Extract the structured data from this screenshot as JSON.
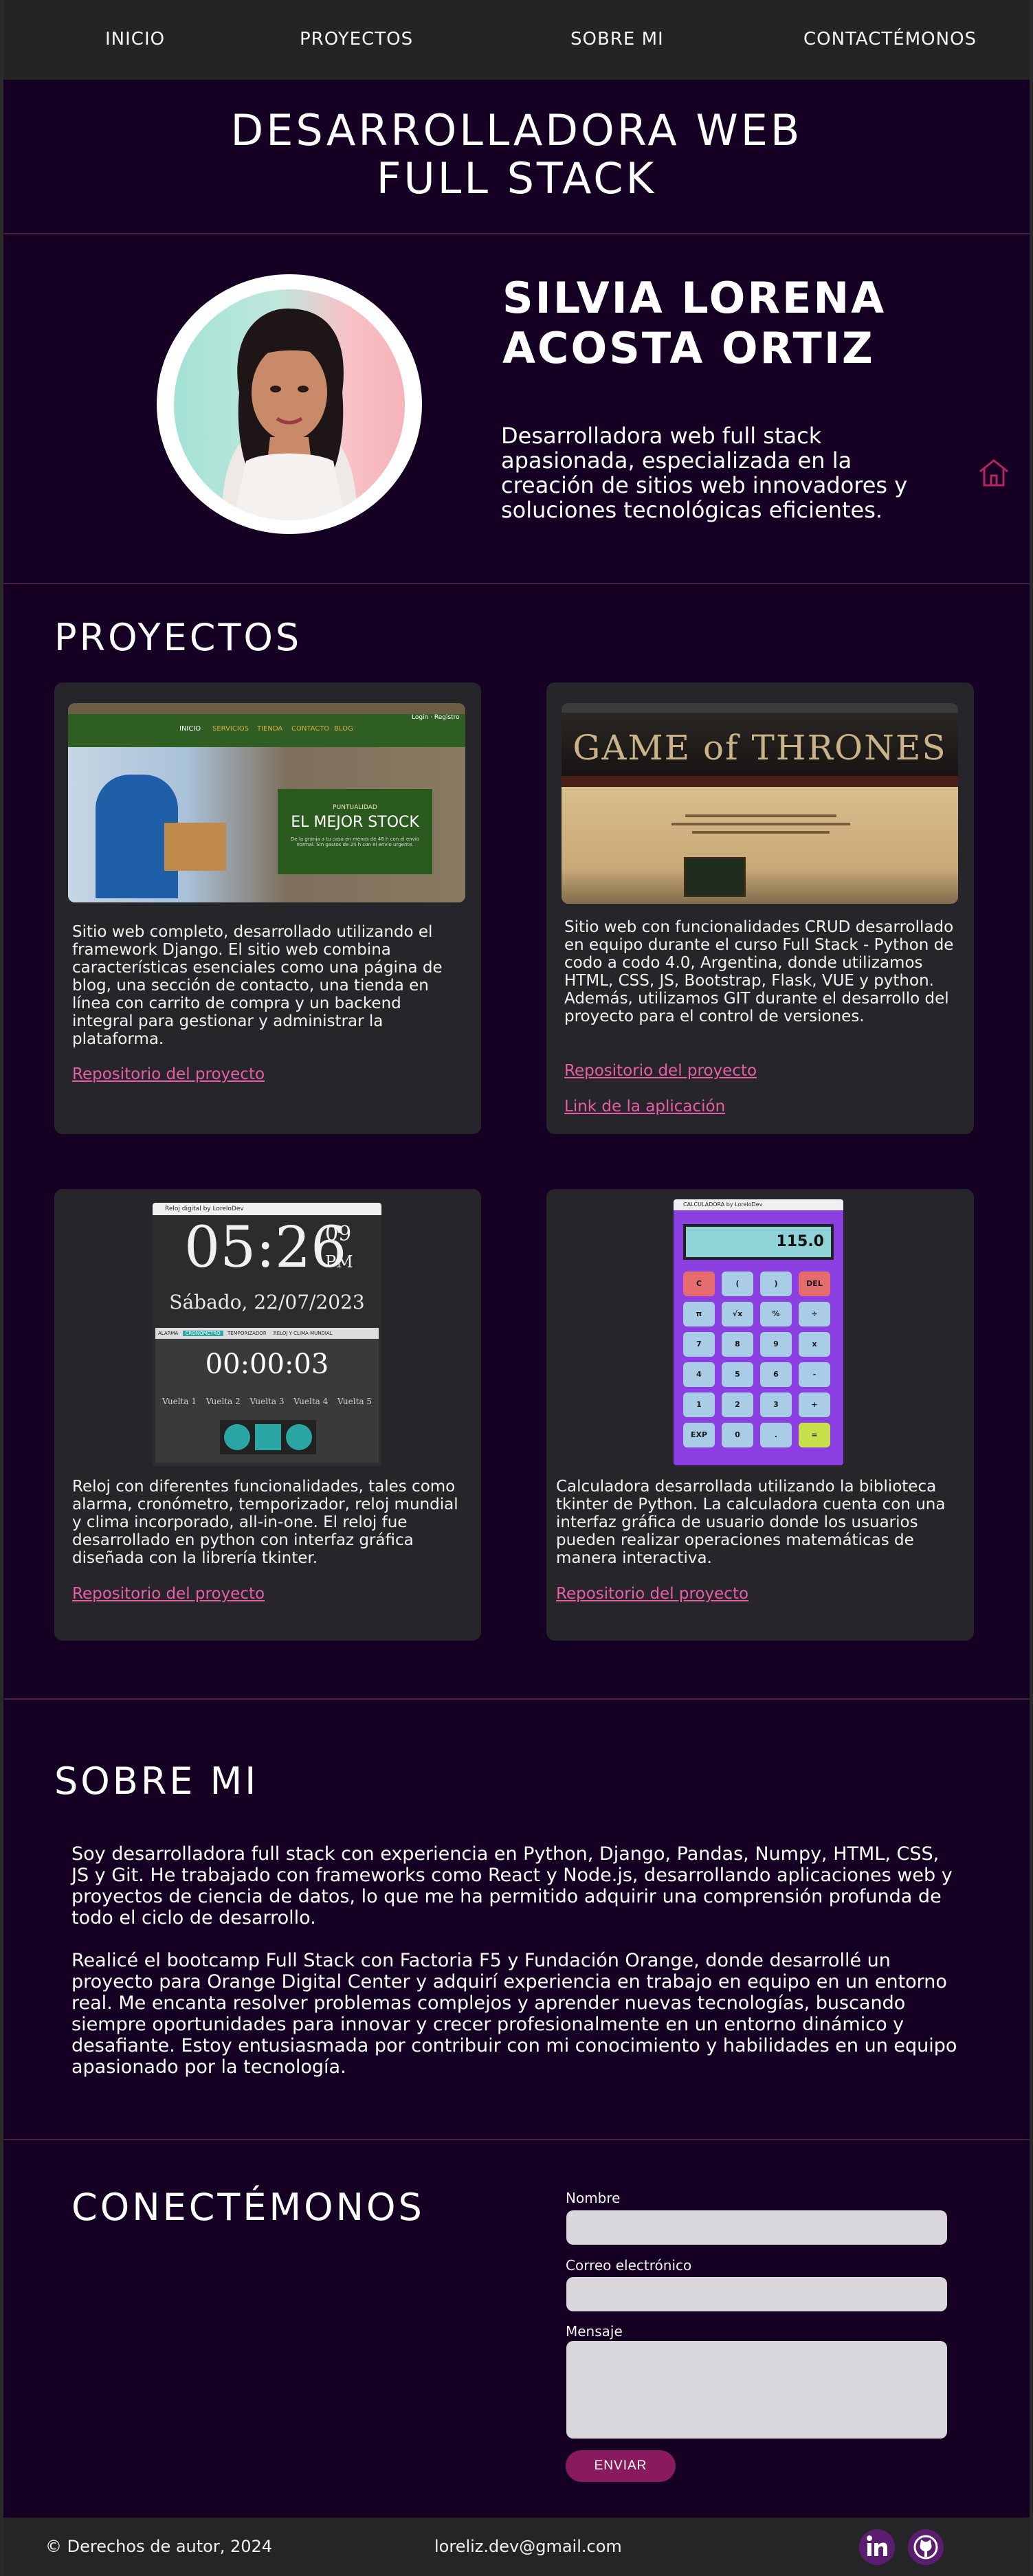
{
  "nav": {
    "items": [
      "INICIO",
      "PROYECTOS",
      "SOBRE MI",
      "CONTACTÉMONOS"
    ]
  },
  "hero": {
    "title_line1": "DESARROLLADORA WEB",
    "title_line2": "FULL STACK"
  },
  "profile": {
    "name_line1": "SILVIA  LORENA",
    "name_line2": "ACOSTA  ORTIZ",
    "tagline": "Desarrolladora web full stack apasionada, especializada en la creación de sitios web innovadores y soluciones tecnológicas eficientes."
  },
  "projects": {
    "title": "PROYECTOS",
    "items": [
      {
        "description": "Sitio web completo, desarrollado utilizando el framework Django. El sitio web combina características esenciales como una página de blog, una sección de contacto, una tienda en línea con carrito de compra y un backend integral para gestionar y administrar la plataforma.",
        "links": [
          "Repositorio del proyecto"
        ],
        "shot": {
          "nav": [
            "INICIO",
            "SERVICIOS",
            "TIENDA",
            "CONTACTO",
            "BLOG"
          ],
          "corner": "Login · Registro",
          "eyebrow": "PUNTUALIDAD",
          "headline": "EL MEJOR STOCK",
          "sub": "De la granja a tu casa en menos de 48 h con el envío normal. Sin gastos de 24 h con el envío urgente."
        }
      },
      {
        "description": "Sitio web con funcionalidades CRUD desarrollado en equipo durante el curso Full Stack - Python de codo a codo 4.0, Argentina, donde utilizamos HTML, CSS, JS, Bootstrap, Flask, VUE y python. Además, utilizamos GIT durante el desarrollo del proyecto para el control de versiones.",
        "links": [
          "Repositorio del proyecto",
          "Link de la aplicación"
        ],
        "shot": {
          "banner": "GAME of THRONES"
        }
      },
      {
        "description": "Reloj con diferentes funcionalidades, tales como alarma, cronómetro, temporizador, reloj mundial y clima incorporado, all-in-one. El reloj fue desarrollado en python con interfaz gráfica diseñada con la librería tkinter.",
        "links": [
          "Repositorio del proyecto"
        ],
        "shot": {
          "window_title": "Reloj digital by LoreloDev",
          "time": "05:26",
          "seconds": "09",
          "ampm": "PM",
          "date": "Sábado, 22/07/2023",
          "tabs": [
            "ALARMA",
            "CRONÓMETRO",
            "TEMPORIZADOR",
            "RELOJ Y CLIMA MUNDIAL"
          ],
          "stopwatch": "00:00:03",
          "laps": [
            "Vuelta 1",
            "Vuelta 2",
            "Vuelta 3",
            "Vuelta 4",
            "Vuelta 5"
          ]
        }
      },
      {
        "description": "Calculadora desarrollada utilizando la biblioteca tkinter de Python. La calculadora cuenta con una interfaz gráfica de usuario donde los usuarios pueden realizar operaciones matemáticas de manera interactiva.",
        "links": [
          "Repositorio del proyecto"
        ],
        "shot": {
          "window_title": "CALCULADORA by LoreloDev",
          "display": "115.0",
          "keys": [
            "C",
            "(",
            ")",
            "DEL",
            "π",
            "√x",
            "%",
            "÷",
            "7",
            "8",
            "9",
            "x",
            "4",
            "5",
            "6",
            "-",
            "1",
            "2",
            "3",
            "+",
            "EXP",
            "0",
            ".",
            "="
          ]
        }
      }
    ]
  },
  "about": {
    "title": "SOBRE MI",
    "p1": "Soy desarrolladora full stack con experiencia en Python, Django, Pandas, Numpy, HTML, CSS, JS y Git. He trabajado con frameworks como React y Node.js, desarrollando aplicaciones web y proyectos de ciencia de datos, lo que me ha permitido adquirir una comprensión profunda de todo el ciclo de desarrollo.",
    "p2": "Realicé el bootcamp Full Stack con Factoria F5 y Fundación Orange, donde desarrollé un proyecto para Orange Digital Center y adquirí experiencia en trabajo en equipo en un entorno real. Me encanta resolver problemas complejos y aprender nuevas tecnologías, buscando siempre oportunidades para innovar y crecer profesionalmente en un entorno dinámico y desafiante. Estoy entusiasmada por contribuir con mi conocimiento y habilidades en un equipo apasionado por la tecnología."
  },
  "contact": {
    "title": "CONECTÉMONOS",
    "name_label": "Nombre",
    "email_label": "Correo electrónico",
    "message_label": "Mensaje",
    "submit_label": "ENVIAR"
  },
  "footer": {
    "copyright": "© Derechos de autor, 2024",
    "email": "loreliz.dev@gmail.com",
    "social_icons": [
      "linkedin-icon",
      "github-icon"
    ]
  },
  "colors": {
    "background": "#150024",
    "bar": "#242427",
    "card": "#25252a",
    "link": "#e75ea4",
    "button": "#8a1a5e"
  }
}
